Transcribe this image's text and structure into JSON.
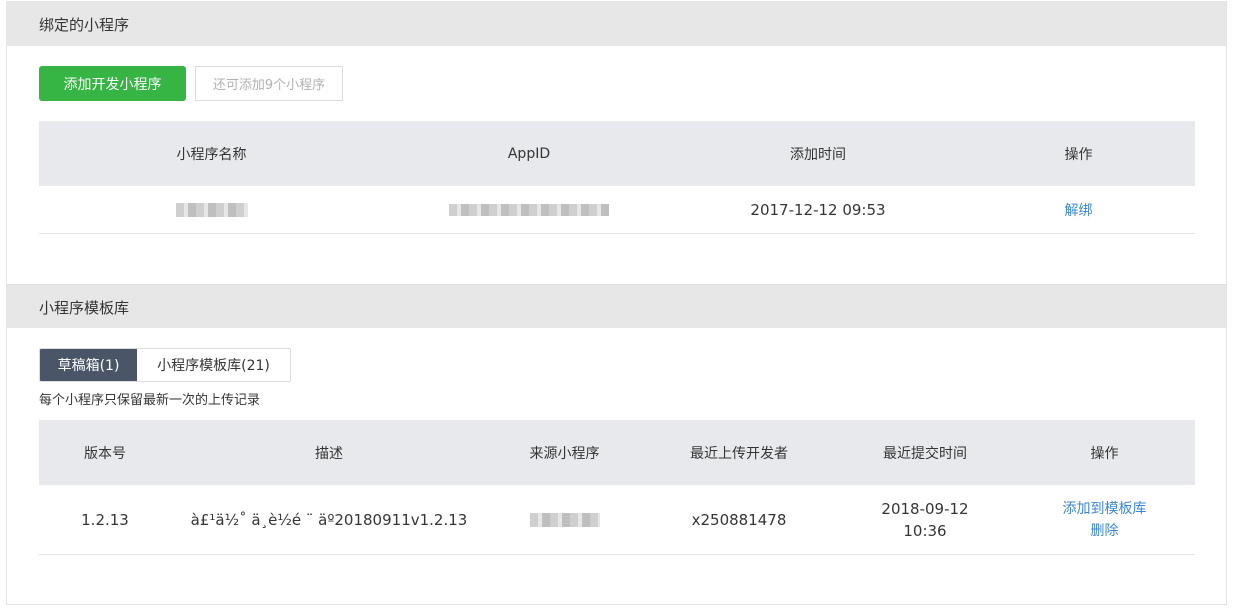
{
  "bound": {
    "section_title": "绑定的小程序",
    "add_button": "添加开发小程序",
    "remaining_hint": "还可添加9个小程序",
    "columns": [
      "小程序名称",
      "AppID",
      "添加时间",
      "操作"
    ],
    "row": {
      "add_time": "2017-12-12 09:53",
      "action": "解绑"
    }
  },
  "templates": {
    "section_title": "小程序模板库",
    "tabs": [
      "草稿箱(1)",
      "小程序模板库(21)"
    ],
    "note": "每个小程序只保留最新一次的上传记录",
    "columns": [
      "版本号",
      "描述",
      "来源小程序",
      "最近上传开发者",
      "最近提交时间",
      "操作"
    ],
    "row": {
      "version": "1.2.13",
      "description": "à£¹ä½˚ ä¸è½é ¨ äº20180911v1.2.13",
      "developer": "x250881478",
      "submit_date": "2018-09-12",
      "submit_time": "10:36",
      "action_add": "添加到模板库",
      "action_delete": "删除"
    }
  }
}
